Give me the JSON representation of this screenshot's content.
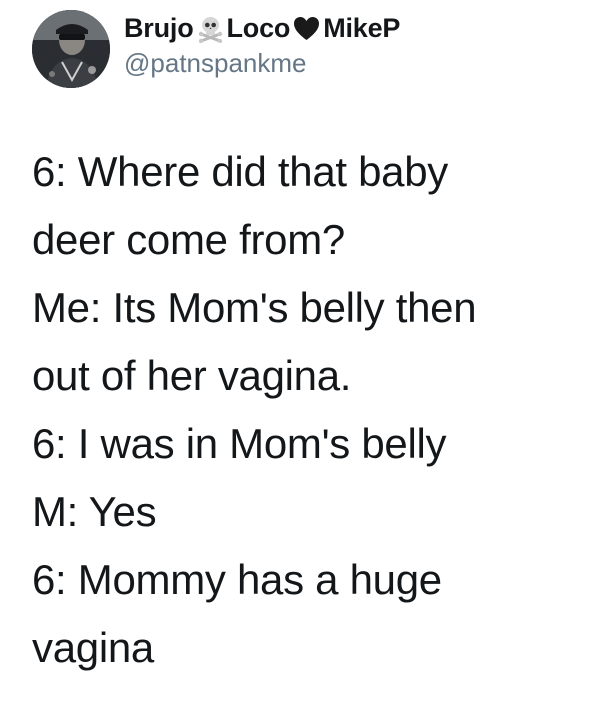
{
  "author": {
    "name_part1": "Brujo",
    "name_part2": "Loco",
    "name_part3": "MikeP",
    "emoji1": "skull-and-crossbones-icon",
    "emoji2": "black-heart-icon",
    "handle": "@patnspankme"
  },
  "tweet": {
    "lines": [
      "6: Where did that baby",
      "deer come from?",
      "Me: Its Mom's belly then",
      "out of her vagina.",
      "6: I was in Mom's belly",
      "M: Yes",
      "6: Mommy has a huge",
      "vagina"
    ]
  },
  "colors": {
    "text": "#14171a",
    "handle": "#657786",
    "background": "#ffffff"
  }
}
